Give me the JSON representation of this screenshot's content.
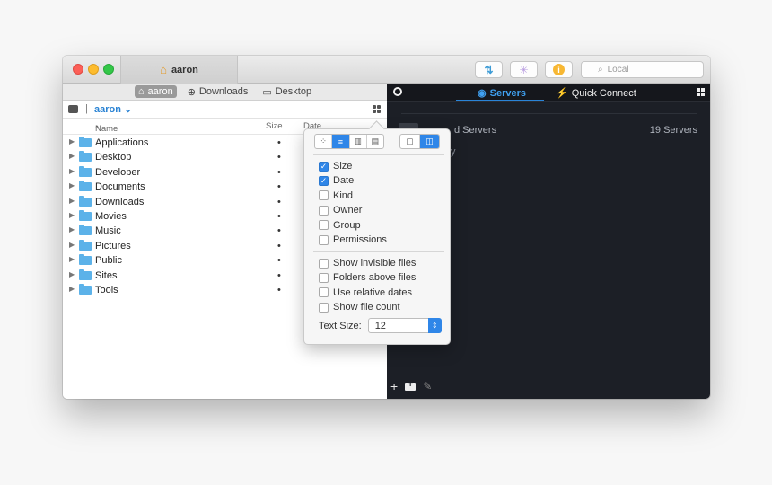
{
  "titlebar": {
    "tab_title": "aaron",
    "search_placeholder": "Local"
  },
  "left": {
    "breadcrumbs": [
      "aaron",
      "Downloads",
      "Desktop"
    ],
    "location": "aaron",
    "columns": {
      "name": "Name",
      "size": "Size",
      "date": "Date"
    },
    "files": [
      {
        "name": "Applications",
        "size": "•"
      },
      {
        "name": "Desktop",
        "size": "•"
      },
      {
        "name": "Developer",
        "size": "•"
      },
      {
        "name": "Documents",
        "size": "•"
      },
      {
        "name": "Downloads",
        "size": "•"
      },
      {
        "name": "Movies",
        "size": "•"
      },
      {
        "name": "Music",
        "size": "•"
      },
      {
        "name": "Pictures",
        "size": "•"
      },
      {
        "name": "Public",
        "size": "•"
      },
      {
        "name": "Sites",
        "size": "•"
      },
      {
        "name": "Tools",
        "size": "•"
      }
    ]
  },
  "right": {
    "tabs": {
      "servers": "Servers",
      "quick_connect": "Quick Connect"
    },
    "saved_label": "d Servers",
    "saved_count": "19 Servers",
    "history_label": "y"
  },
  "popover": {
    "columns": [
      {
        "label": "Size",
        "checked": true
      },
      {
        "label": "Date",
        "checked": true
      },
      {
        "label": "Kind",
        "checked": false
      },
      {
        "label": "Owner",
        "checked": false
      },
      {
        "label": "Group",
        "checked": false
      },
      {
        "label": "Permissions",
        "checked": false
      }
    ],
    "options": [
      {
        "label": "Show invisible files",
        "checked": false
      },
      {
        "label": "Folders above files",
        "checked": false
      },
      {
        "label": "Use relative dates",
        "checked": false
      },
      {
        "label": "Show file count",
        "checked": false
      }
    ],
    "text_size_label": "Text Size:",
    "text_size_value": "12"
  },
  "colors": {
    "accent": "#2f86e8",
    "folder": "#5cb2e9",
    "dark_bg": "#1c1f26"
  }
}
